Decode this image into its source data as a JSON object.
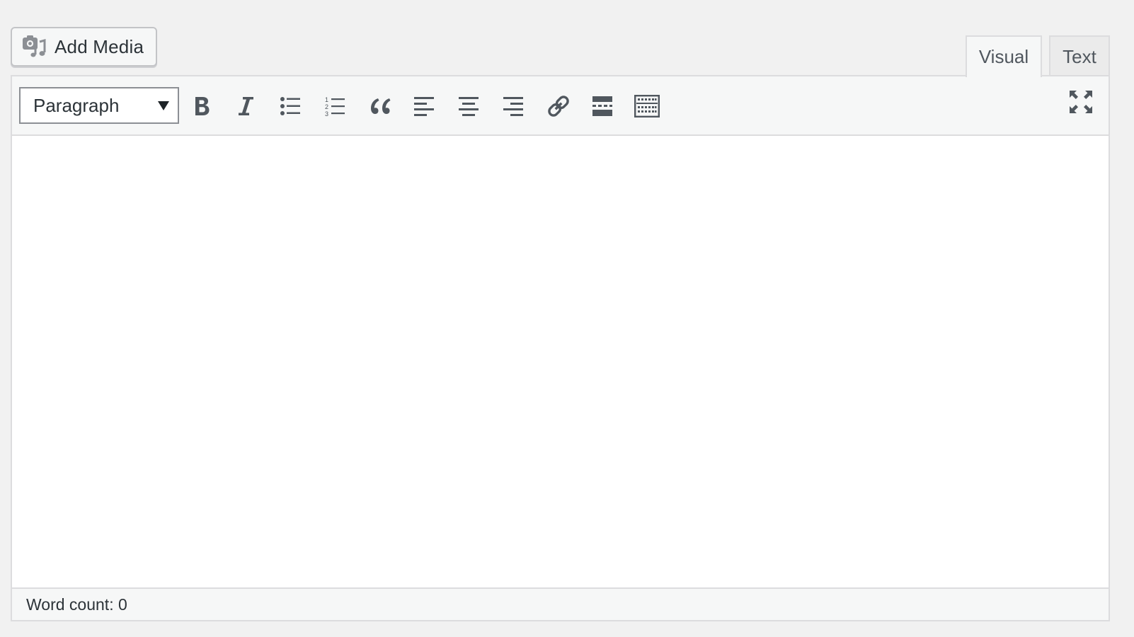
{
  "media_button": {
    "label": "Add Media",
    "icon": "add-media-icon"
  },
  "editor_tabs": [
    {
      "label": "Visual",
      "active": true
    },
    {
      "label": "Text",
      "active": false
    }
  ],
  "toolbar": {
    "format_select": {
      "selected": "Paragraph"
    },
    "buttons": [
      "bold-icon",
      "italic-icon",
      "bulleted-list-icon",
      "numbered-list-icon",
      "blockquote-icon",
      "align-left-icon",
      "align-center-icon",
      "align-right-icon",
      "link-icon",
      "read-more-icon",
      "toolbar-toggle-icon",
      "fullscreen-icon"
    ]
  },
  "status_bar": {
    "word_count": "Word count: 0"
  },
  "colors": {
    "icon": "#50575e",
    "border": "#dcdcde",
    "toolbar_bg": "#f6f7f7",
    "page_bg": "#f1f1f1"
  }
}
